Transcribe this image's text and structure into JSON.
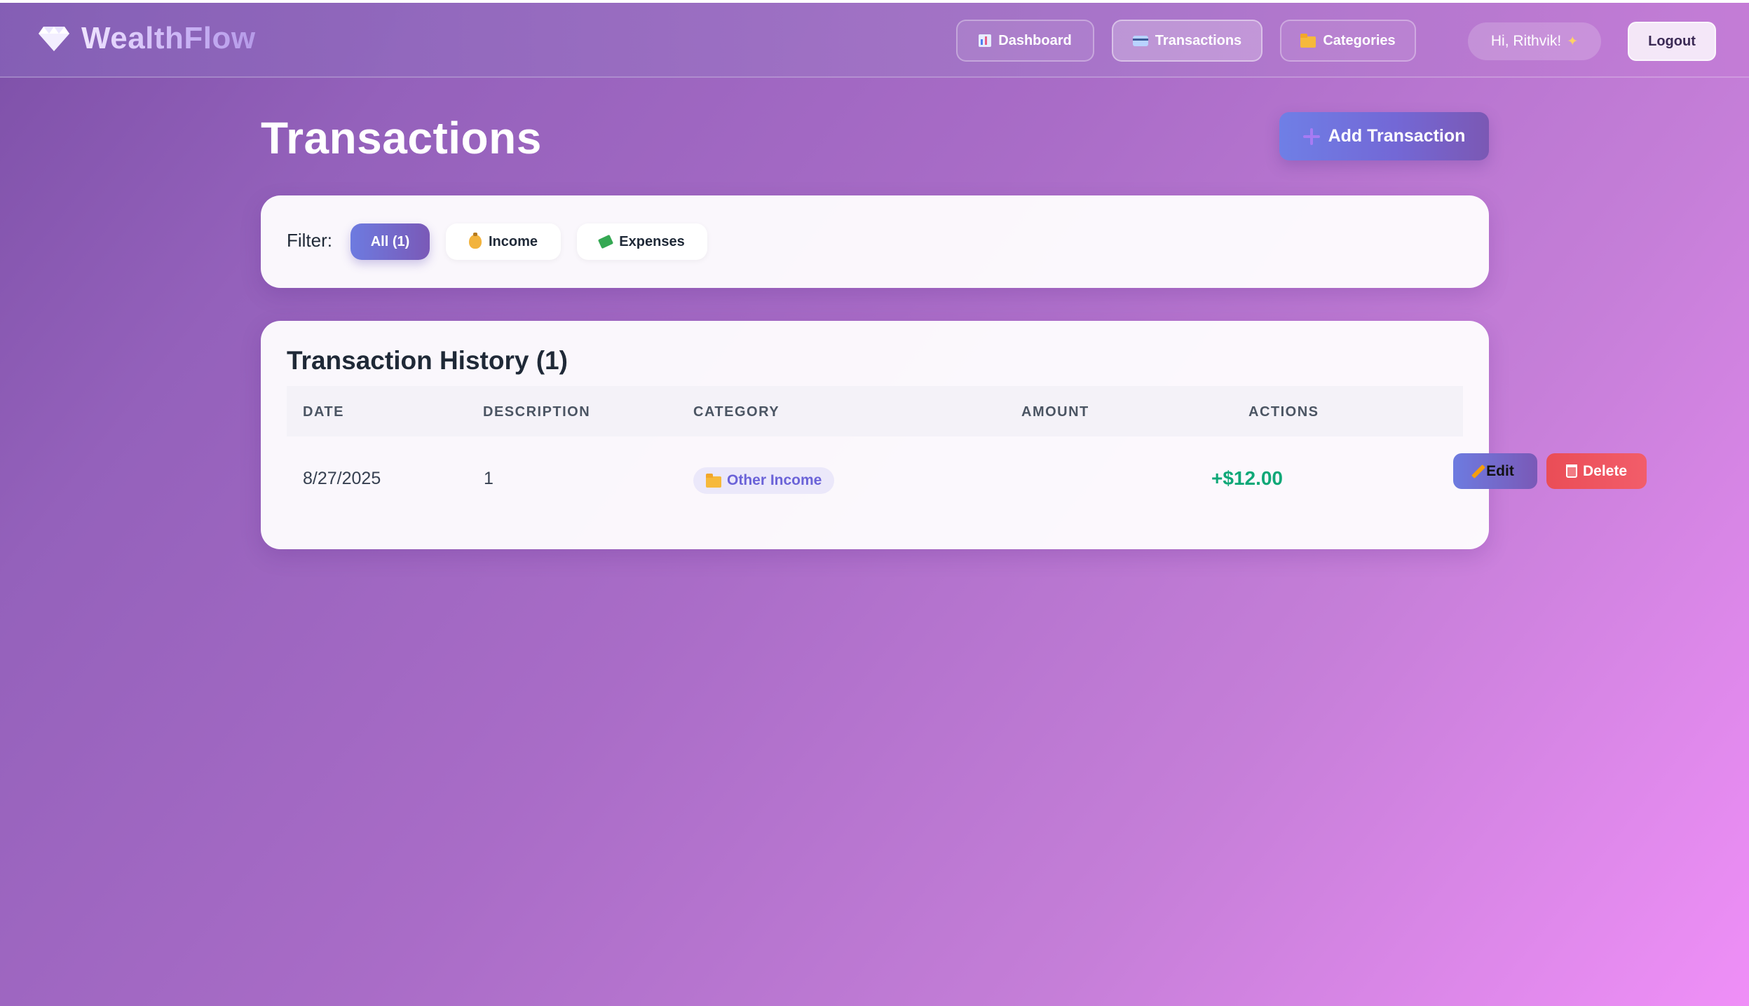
{
  "app": {
    "name": "WealthFlow"
  },
  "colors": {
    "primary": "#7368d6",
    "income": "#10a878",
    "danger": "#ea4d56",
    "background_start": "#7d50a8",
    "background_end": "#ef8ff7"
  },
  "icons": {
    "brand": "diamond-icon",
    "dashboard": "bar-chart-icon",
    "transactions": "credit-card-icon",
    "categories": "folder-icon",
    "add": "plus-icon",
    "income": "money-bag-icon",
    "expenses": "money-with-wings-icon",
    "edit": "pencil-icon",
    "delete": "trash-icon",
    "greeting": "sparkle-icon"
  },
  "nav": {
    "dashboard": "Dashboard",
    "transactions": "Transactions",
    "categories": "Categories",
    "greeting": "Hi, Rithvik!",
    "logout": "Logout",
    "active": "Transactions"
  },
  "page": {
    "title": "Transactions",
    "add_button": "Add Transaction"
  },
  "filter": {
    "label": "Filter:",
    "options": [
      {
        "label": "All (1)",
        "active": true
      },
      {
        "label": "Income",
        "active": false
      },
      {
        "label": "Expenses",
        "active": false
      }
    ]
  },
  "history": {
    "title": "Transaction History (1)",
    "columns": [
      "DATE",
      "DESCRIPTION",
      "CATEGORY",
      "AMOUNT",
      "ACTIONS"
    ],
    "rows": [
      {
        "date": "8/27/2025",
        "description": "1",
        "category": "Other Income",
        "amount": "+$12.00",
        "edit_label": "Edit",
        "delete_label": "Delete"
      }
    ]
  }
}
